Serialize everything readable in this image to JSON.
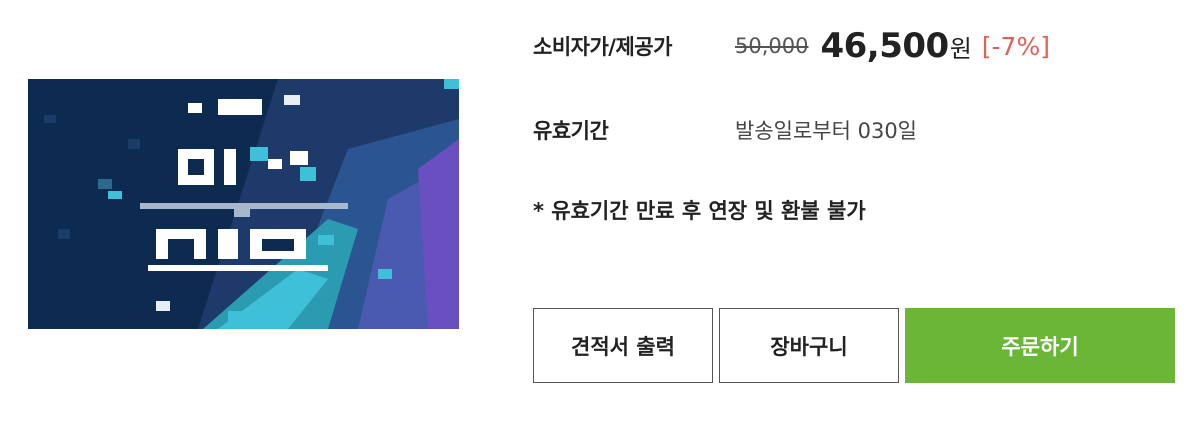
{
  "product": {
    "image": {
      "icon": "pixel-mosaic-thumbnail",
      "colors": [
        "#0d2a50",
        "#1e3a6a",
        "#2a9bb0",
        "#3ec0d8",
        "#6a4fc0"
      ]
    }
  },
  "price": {
    "label": "소비자가/제공가",
    "original": "50,000",
    "sale": "46,500",
    "currency": "원",
    "discount": "[-7%]",
    "discount_color": "#e0605a"
  },
  "validity": {
    "label": "유효기간",
    "value": "발송일로부터 030일"
  },
  "notice": "* 유효기간 만료 후 연장 및 환불 불가",
  "buttons": {
    "quote": "견적서 출력",
    "cart": "장바구니",
    "order": "주문하기",
    "order_color": "#6ab737"
  }
}
